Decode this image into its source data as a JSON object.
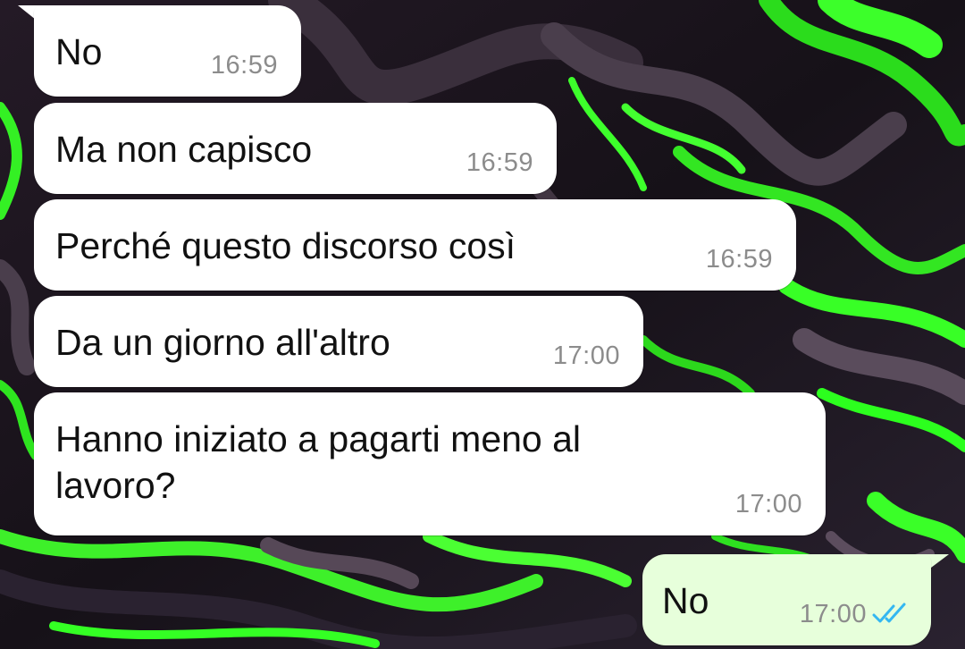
{
  "chat": {
    "messages": [
      {
        "direction": "incoming",
        "text": "No",
        "time": "16:59"
      },
      {
        "direction": "incoming",
        "text": "Ma non capisco",
        "time": "16:59"
      },
      {
        "direction": "incoming",
        "text": "Perché questo discorso così",
        "time": "16:59"
      },
      {
        "direction": "incoming",
        "text": "Da un giorno all'altro",
        "time": "17:00"
      },
      {
        "direction": "incoming",
        "text": "Hanno iniziato a pagarti meno al\nlavoro?",
        "time": "17:00"
      },
      {
        "direction": "outgoing",
        "text": "No",
        "time": "17:00",
        "status": "read"
      }
    ]
  },
  "icons": {
    "read_receipt": "double-check-icon"
  },
  "colors": {
    "incoming_bubble": "#ffffff",
    "outgoing_bubble": "#e7ffdb",
    "timestamp": "#8c8c8c",
    "read_tick": "#34b7f1",
    "wallpaper_green": "#33ff22",
    "wallpaper_dark": "#1a141c"
  }
}
